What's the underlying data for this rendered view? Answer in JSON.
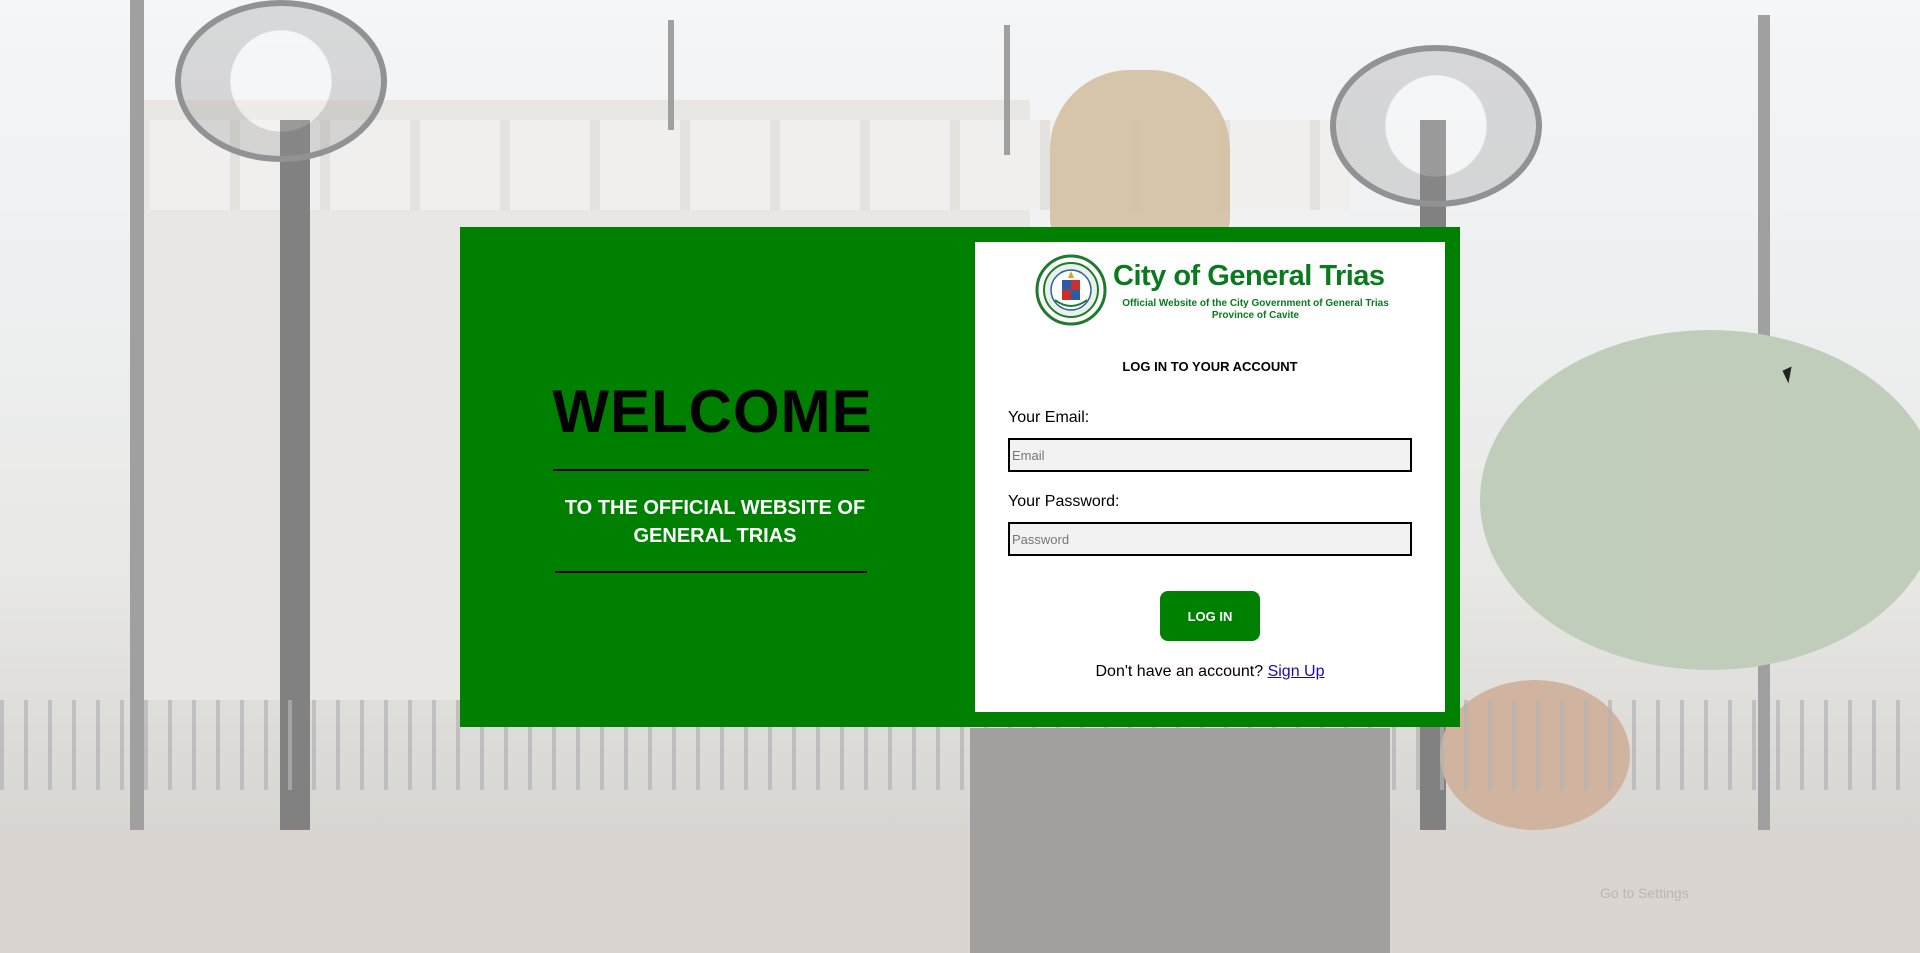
{
  "welcome": {
    "title": "WELCOME",
    "subtitle": "TO THE OFFICIAL WEBSITE OF GENERAL TRIAS"
  },
  "logo": {
    "title": "City of General Trias",
    "line1": "Official Website of the City Government of General Trias",
    "line2": "Province of Cavite",
    "seal_icon": "city-seal-icon"
  },
  "login": {
    "heading": "LOG IN TO YOUR ACCOUNT",
    "email_label": "Your Email:",
    "email_placeholder": "Email",
    "email_value": "",
    "password_label": "Your Password:",
    "password_placeholder": "Password",
    "password_value": "",
    "button_label": "LOG IN",
    "signup_prompt": "Don't have an account?",
    "signup_link": "Sign Up"
  },
  "background": {
    "watermark": "Go to Settings"
  },
  "colors": {
    "brand_green": "#008000",
    "logo_green": "#0a7a1e",
    "link_blue": "#1a0dab"
  }
}
